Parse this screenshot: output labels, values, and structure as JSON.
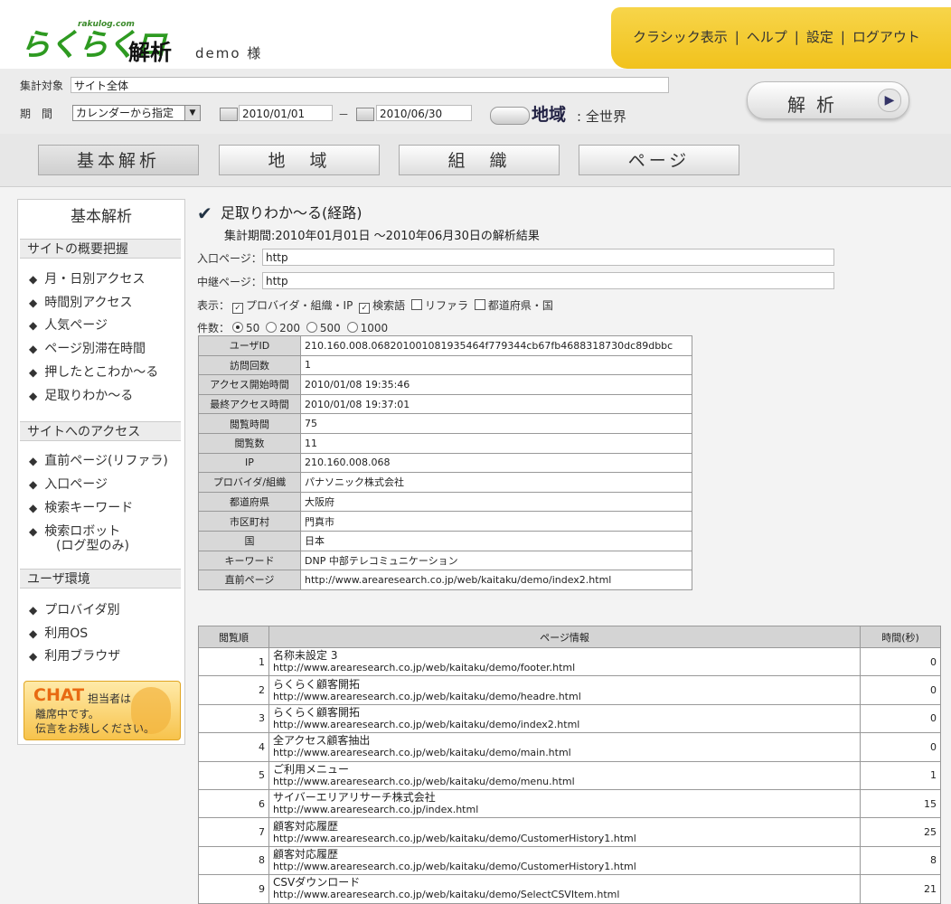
{
  "header": {
    "logo_text": "らくらくログ",
    "logo_suffix": "解析",
    "logo_sub": "rakulog.com",
    "user": "demo 様",
    "menu": [
      "クラシック表示",
      "ヘルプ",
      "設定",
      "ログアウト"
    ],
    "menu_sep": "|"
  },
  "conditions": {
    "target_label": "集計対象",
    "target_value": "サイト全体",
    "period_label": "期　間",
    "period_select": "カレンダーから指定",
    "date_from": "2010/01/01",
    "date_sep": "－",
    "date_to": "2010/06/30",
    "region_label": "地域",
    "region_colon": ":",
    "region_value": "全世界",
    "analyze_label": "解析",
    "play_glyph": "▶"
  },
  "tabs": [
    "基本解析",
    "地　域",
    "組　織",
    "ページ"
  ],
  "sidebar": {
    "title": "基本解析",
    "sections": [
      {
        "title": "サイトの概要把握",
        "items": [
          "月・日別アクセス",
          "時間別アクセス",
          "人気ページ",
          "ページ別滞在時間",
          "押したとこわか～る",
          "足取りわか～る"
        ]
      },
      {
        "title": "サイトへのアクセス",
        "items": [
          "直前ページ(リファラ)",
          "入口ページ",
          "検索キーワード",
          "検索ロボット"
        ],
        "note": "(ログ型のみ)"
      },
      {
        "title": "ユーザ環境",
        "items": [
          "プロバイダ別",
          "利用OS",
          "利用ブラウザ"
        ]
      }
    ],
    "bullet": "◆",
    "chat": {
      "title": "CHAT",
      "line1": "担当者は",
      "line2": "離席中です。",
      "line3": "伝言をお残しください。"
    }
  },
  "main": {
    "heading": "足取りわか～る(経路)",
    "checkmark": "✔",
    "period_text": "集計期間:2010年01月01日 ～2010年06月30日の解析結果",
    "entry_label": "入口ページ：",
    "entry_value": "http",
    "relay_label": "中継ページ：",
    "relay_value": "http",
    "display_label": "表示：",
    "display_options": [
      {
        "label": "プロバイダ・組織・IP",
        "checked": true
      },
      {
        "label": "検索語",
        "checked": true
      },
      {
        "label": "リファラ",
        "checked": false
      },
      {
        "label": "都道府県・国",
        "checked": false
      }
    ],
    "count_label": "件数：",
    "count_options": [
      {
        "label": "50",
        "selected": true
      },
      {
        "label": "200",
        "selected": false
      },
      {
        "label": "500",
        "selected": false
      },
      {
        "label": "1000",
        "selected": false
      }
    ],
    "info": [
      [
        "ユーザID",
        "210.160.008.068201001081935464f779344cb67fb4688318730dc89dbbc"
      ],
      [
        "訪問回数",
        "1"
      ],
      [
        "アクセス開始時間",
        "2010/01/08 19:35:46"
      ],
      [
        "最終アクセス時間",
        "2010/01/08 19:37:01"
      ],
      [
        "閲覧時間",
        "75"
      ],
      [
        "閲覧数",
        "11"
      ],
      [
        "IP",
        "210.160.008.068"
      ],
      [
        "プロバイダ/組織",
        "パナソニック株式会社"
      ],
      [
        "都道府県",
        "大阪府"
      ],
      [
        "市区町村",
        "門真市"
      ],
      [
        "国",
        "日本"
      ],
      [
        "キーワード",
        "DNP 中部テレコミュニケーション"
      ],
      [
        "直前ページ",
        "http://www.arearesearch.co.jp/web/kaitaku/demo/index2.html"
      ]
    ],
    "pages_headers": [
      "閲覧順",
      "ページ情報",
      "時間(秒)"
    ],
    "pages": [
      {
        "n": "1",
        "title": "名称未設定 3",
        "url": "http://www.arearesearch.co.jp/web/kaitaku/demo/footer.html",
        "sec": "0"
      },
      {
        "n": "2",
        "title": "らくらく顧客開拓",
        "url": "http://www.arearesearch.co.jp/web/kaitaku/demo/headre.html",
        "sec": "0"
      },
      {
        "n": "3",
        "title": "らくらく顧客開拓",
        "url": "http://www.arearesearch.co.jp/web/kaitaku/demo/index2.html",
        "sec": "0"
      },
      {
        "n": "4",
        "title": "全アクセス顧客抽出",
        "url": "http://www.arearesearch.co.jp/web/kaitaku/demo/main.html",
        "sec": "0"
      },
      {
        "n": "5",
        "title": "ご利用メニュー",
        "url": "http://www.arearesearch.co.jp/web/kaitaku/demo/menu.html",
        "sec": "1"
      },
      {
        "n": "6",
        "title": "サイバーエリアリサーチ株式会社",
        "url": "http://www.arearesearch.co.jp/index.html",
        "sec": "15"
      },
      {
        "n": "7",
        "title": "顧客対応履歴",
        "url": "http://www.arearesearch.co.jp/web/kaitaku/demo/CustomerHistory1.html",
        "sec": "25"
      },
      {
        "n": "8",
        "title": "顧客対応履歴",
        "url": "http://www.arearesearch.co.jp/web/kaitaku/demo/CustomerHistory1.html",
        "sec": "8"
      },
      {
        "n": "9",
        "title": "CSVダウンロード",
        "url": "http://www.arearesearch.co.jp/web/kaitaku/demo/SelectCSVItem.html",
        "sec": "21"
      }
    ]
  }
}
